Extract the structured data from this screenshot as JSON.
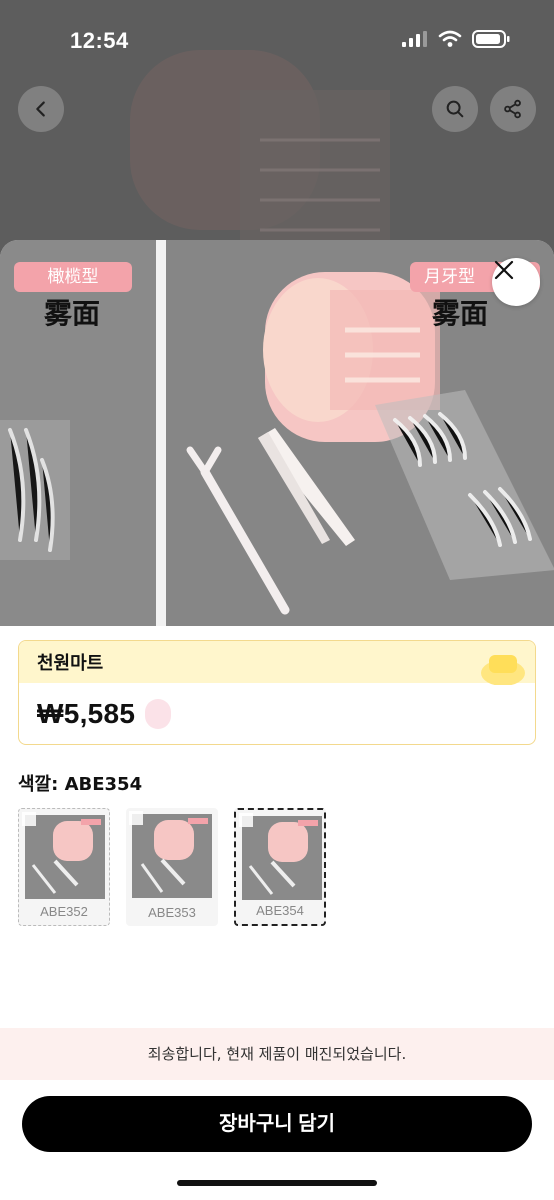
{
  "status_bar": {
    "time": "12:54"
  },
  "header": {
    "back_icon": "chevron-left-icon",
    "search_icon": "search-icon",
    "share_icon": "share-icon"
  },
  "product_image": {
    "left_tag": "橄榄型",
    "left_label": "雾面",
    "right_tag": "月牙型",
    "right_label": "雾面",
    "close_icon": "close-icon"
  },
  "seller": {
    "name": "천원마트"
  },
  "price": {
    "value": "₩5,585"
  },
  "option": {
    "label": "색깔: ABE354",
    "swatches": [
      {
        "label": "ABE352",
        "selected": false
      },
      {
        "label": "ABE353",
        "selected": false
      },
      {
        "label": "ABE354",
        "selected": true
      }
    ]
  },
  "notice": {
    "text": "죄송합니다, 현재 제품이 매진되었습니다."
  },
  "cart_button": {
    "label": "장바구니 담기"
  },
  "colors": {
    "accent_tag": "#f3a3aa",
    "price_card_head": "#fff6cc",
    "notice_bg": "#fdf0ee",
    "button_bg": "#000000"
  }
}
